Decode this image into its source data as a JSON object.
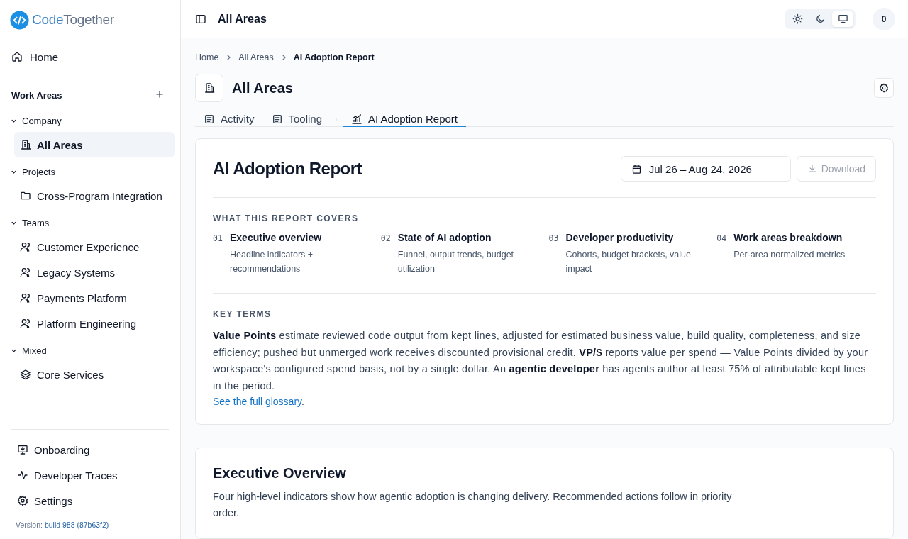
{
  "brand": {
    "name_part1": "Code",
    "name_part2": "Together"
  },
  "sidebar": {
    "home": {
      "label": "Home",
      "selected": false
    },
    "section_title": "Work Areas",
    "groups": [
      {
        "label": "Company",
        "expanded": true,
        "items": [
          {
            "label": "All Areas",
            "kind": "building",
            "selected": true
          }
        ]
      },
      {
        "label": "Projects",
        "expanded": true,
        "items": [
          {
            "label": "Cross-Program Integration",
            "kind": "folder",
            "selected": false
          }
        ]
      },
      {
        "label": "Teams",
        "expanded": true,
        "items": [
          {
            "label": "Customer Experience",
            "kind": "team",
            "selected": false
          },
          {
            "label": "Legacy Systems",
            "kind": "team",
            "selected": false
          },
          {
            "label": "Payments Platform",
            "kind": "team",
            "selected": false
          },
          {
            "label": "Platform Engineering",
            "kind": "team",
            "selected": false
          }
        ]
      },
      {
        "label": "Mixed",
        "expanded": true,
        "items": [
          {
            "label": "Core Services",
            "kind": "layers",
            "selected": false
          }
        ]
      }
    ],
    "footer_items": [
      {
        "label": "Onboarding",
        "kind": "monitor"
      },
      {
        "label": "Developer Traces",
        "kind": "pulse"
      },
      {
        "label": "Settings",
        "kind": "gear"
      }
    ],
    "version_label": "Version:",
    "version": "build 988 (87b63f2)"
  },
  "header": {
    "title": "All Areas",
    "theme_options": [
      {
        "kind": "light",
        "selected": false
      },
      {
        "kind": "dark",
        "selected": false
      },
      {
        "kind": "system",
        "selected": true
      }
    ],
    "avatar": "0"
  },
  "breadcrumb": [
    {
      "label": "Home",
      "current": false
    },
    {
      "label": "All Areas",
      "current": false
    },
    {
      "label": "AI Adoption Report",
      "current": true
    }
  ],
  "page": {
    "title": "All Areas"
  },
  "tabs": [
    {
      "label": "Activity",
      "kind": "doc",
      "selected": false
    },
    {
      "label": "Tooling",
      "kind": "doc",
      "selected": false
    },
    {
      "label": "AI Adoption Report",
      "kind": "chart",
      "selected": true
    }
  ],
  "report": {
    "title": "AI Adoption Report",
    "date_range": "Jul 26 – Aug 24, 2026",
    "download": {
      "label": "Download",
      "disabled": true
    },
    "covers_heading": "WHAT THIS REPORT COVERS",
    "covers": [
      {
        "number": "01",
        "title": "Executive overview",
        "description": "Headline indicators + recommendations"
      },
      {
        "number": "02",
        "title": "State of AI adoption",
        "description": "Funnel, output trends, budget utilization"
      },
      {
        "number": "03",
        "title": "Developer productivity",
        "description": "Cohorts, budget brackets, value impact"
      },
      {
        "number": "04",
        "title": "Work areas breakdown",
        "description": "Per-area normalized metrics"
      }
    ],
    "key_terms_heading": "KEY TERMS",
    "key_terms": "**Value Points** estimate reviewed code output from kept lines, adjusted for estimated business value, build quality, completeness, and size efficiency; pushed but unmerged work receives discounted provisional credit. **VP/$** reports value per spend — Value Points divided by your workspace's configured spend basis, not by a single dollar. An **agentic developer** has agents author at least 75% of attributable kept lines in the period.",
    "glossary_link": "See the full glossary",
    "glossary_suffix": "."
  },
  "overview": {
    "title": "Executive Overview",
    "description": "Four high-level indicators show how agentic adoption is changing delivery. Recommended actions follow in priority order."
  }
}
